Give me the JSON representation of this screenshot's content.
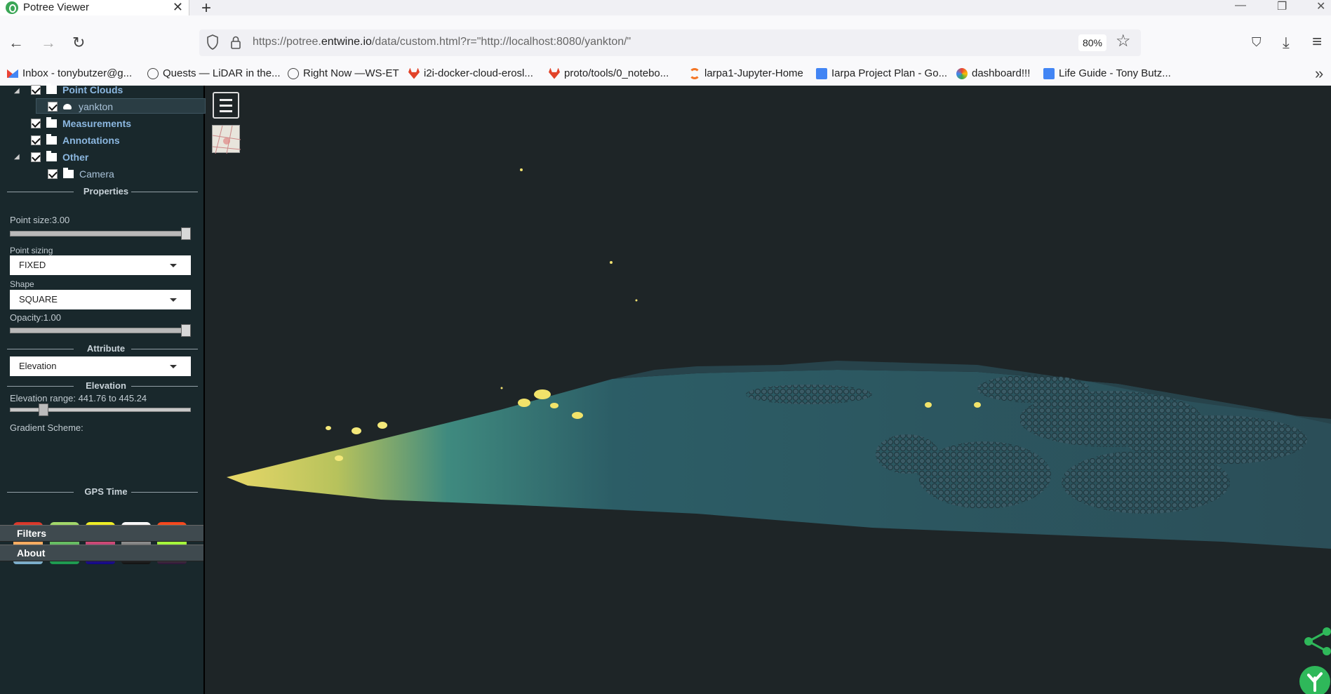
{
  "browser": {
    "tab_title": "Potree Viewer",
    "tab_close": "✕",
    "new_tab": "+",
    "window_controls": {
      "minimize": "—",
      "restore": "❐",
      "close": "✕"
    },
    "url_prefix": "https://potree.",
    "url_host": "entwine.io",
    "url_rest": "/data/custom.html?r=\"http://localhost:8080/yankton/\"",
    "zoom": "80%",
    "nav": {
      "back": "←",
      "forward": "→",
      "reload": "↻",
      "star": "☆",
      "pocket": "⛉",
      "download": "⤓",
      "menu": "≡",
      "overflow": "»"
    }
  },
  "bookmarks": [
    {
      "label": "Inbox - tonybutzer@g...",
      "icon": "gmail-icon",
      "color": "#d93025"
    },
    {
      "label": "Quests — LiDAR in the...",
      "icon": "globe-icon",
      "color": "#444444"
    },
    {
      "label": "Right Now —WS-ET",
      "icon": "globe-icon",
      "color": "#444444"
    },
    {
      "label": "i2i-docker-cloud-erosl...",
      "icon": "gitlab-icon",
      "color": "#e24329"
    },
    {
      "label": "proto/tools/0_notebo...",
      "icon": "gitlab-icon",
      "color": "#e24329"
    },
    {
      "label": "larpa1-Jupyter-Home",
      "icon": "jupyter-icon",
      "color": "#f37626"
    },
    {
      "label": "Iarpa Project Plan - Go...",
      "icon": "docs-icon",
      "color": "#4285f4"
    },
    {
      "label": "dashboard!!!",
      "icon": "dashboard-icon",
      "color": "#ea4335"
    },
    {
      "label": "Life Guide - Tony Butz...",
      "icon": "docs-icon",
      "color": "#4285f4"
    }
  ],
  "sidebar": {
    "tree": {
      "point_clouds": "Point Clouds",
      "yankton": "yankton",
      "measurements": "Measurements",
      "annotations": "Annotations",
      "other": "Other",
      "camera": "Camera"
    },
    "properties": {
      "header": "Properties",
      "point_size_label": "Point size:",
      "point_size_value": "3.00",
      "point_size_fraction": 1.0,
      "point_sizing_label": "Point sizing",
      "point_sizing_value": "FIXED",
      "shape_label": "Shape",
      "shape_value": "SQUARE",
      "opacity_label": "Opacity:",
      "opacity_value": "1.00",
      "opacity_fraction": 1.0
    },
    "attribute": {
      "header": "Attribute",
      "value": "Elevation"
    },
    "elevation": {
      "header": "Elevation",
      "range_label": "Elevation range: ",
      "range_value": "441.76 to 445.24",
      "slider_fraction": 0.2,
      "gradient_label": "Gradient Scheme:",
      "gradients": [
        {
          "name": "spectral",
          "colors": [
            "#d73027",
            "#fdae61",
            "#74add1"
          ]
        },
        {
          "name": "yellow-green",
          "colors": [
            "#a6d96a",
            "#66bd63",
            "#1a9850"
          ]
        },
        {
          "name": "plasma",
          "colors": [
            "#f0f921",
            "#cc4778",
            "#0d0887"
          ]
        },
        {
          "name": "grayscale",
          "colors": [
            "#ffffff",
            "#888888",
            "#111111"
          ]
        },
        {
          "name": "turbo",
          "colors": [
            "#f93c1c",
            "#a4fc3c",
            "#30123b"
          ]
        }
      ]
    },
    "gps_time": {
      "header": "GPS Time"
    },
    "filters": "Filters",
    "about": "About"
  }
}
